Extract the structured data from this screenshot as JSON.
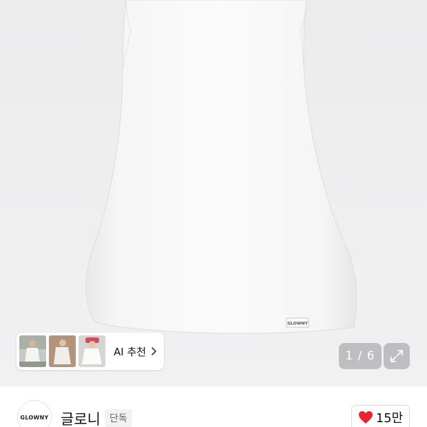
{
  "hero": {
    "label_text": "GLOWNY"
  },
  "ai_recommend": {
    "label": "AI 추천",
    "thumbnails": [
      "thumbnail-1",
      "thumbnail-2",
      "thumbnail-3"
    ]
  },
  "gallery": {
    "counter": "1 / 6"
  },
  "brand": {
    "logo_text": "GLOWNY",
    "name": "글로니",
    "badge": "단독"
  },
  "like": {
    "count": "15만",
    "icon": "heart-icon",
    "color": "#e8222e"
  },
  "colors": {
    "background": "#efeff0",
    "overlay": "#96969b"
  }
}
